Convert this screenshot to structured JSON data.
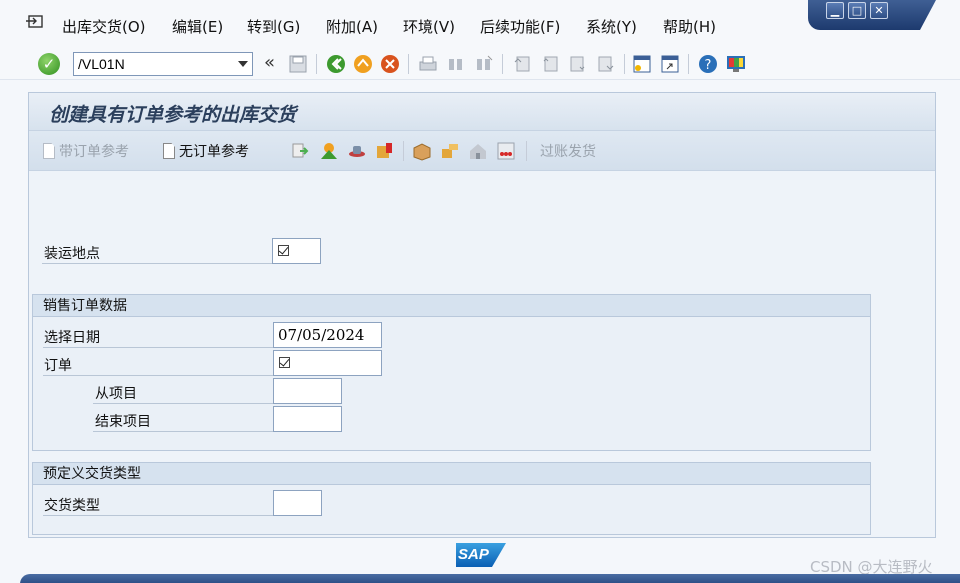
{
  "menubar": {
    "items": [
      {
        "label": "出库交货(O)"
      },
      {
        "label": "编辑(E)"
      },
      {
        "label": "转到(G)"
      },
      {
        "label": "附加(A)"
      },
      {
        "label": "环境(V)"
      },
      {
        "label": "后续功能(F)"
      },
      {
        "label": "系统(Y)"
      },
      {
        "label": "帮助(H)"
      }
    ]
  },
  "window_controls": {
    "minimize": "▁",
    "maximize": "□",
    "close": "✕"
  },
  "systoolbar": {
    "command": "/VL01N",
    "back_label": "«"
  },
  "screen": {
    "title": "创建具有订单参考的出库交货"
  },
  "apptoolbar": {
    "with_order_ref": "带订单参考",
    "without_order_ref": "无订单参考",
    "post_goods_issue": "过账发货"
  },
  "form": {
    "shipping_point_label": "装运地点",
    "sales_order_group": "销售订单数据",
    "selection_date_label": "选择日期",
    "selection_date_value": "07/05/2024",
    "order_label": "订单",
    "from_item_label": "从项目",
    "to_item_label": "结束项目",
    "predefined_group": "预定义交货类型",
    "delivery_type_label": "交货类型"
  },
  "footer": {
    "logo": "SAP",
    "watermark": "CSDN @大连野火"
  }
}
